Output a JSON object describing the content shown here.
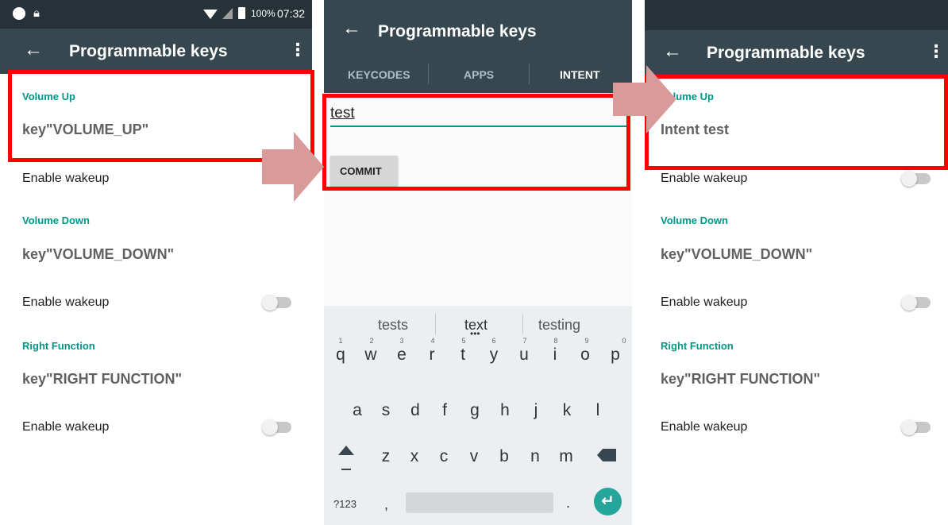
{
  "status_bar": {
    "battery": "100%",
    "time": "07:32"
  },
  "screen1": {
    "title": "Programmable keys",
    "items": [
      {
        "category": "Volume Up",
        "value": "key\"VOLUME_UP\"",
        "wakeup": "Enable wakeup"
      },
      {
        "category": "Volume Down",
        "value": "key\"VOLUME_DOWN\"",
        "wakeup": "Enable wakeup"
      },
      {
        "category": "Right Function",
        "value": "key\"RIGHT FUNCTION\"",
        "wakeup": "Enable wakeup"
      }
    ]
  },
  "screen2": {
    "title": "Programmable keys",
    "tabs": [
      "KEYCODES",
      "APPS",
      "INTENT"
    ],
    "input_value": "test",
    "commit_label": "COMMIT",
    "suggestions": [
      "tests",
      "text",
      "testing"
    ],
    "rows": {
      "row1": [
        "q",
        "w",
        "e",
        "r",
        "t",
        "y",
        "u",
        "i",
        "o",
        "p"
      ],
      "row1_hints": [
        "1",
        "2",
        "3",
        "4",
        "5",
        "6",
        "7",
        "8",
        "9",
        "0"
      ],
      "row2": [
        "a",
        "s",
        "d",
        "f",
        "g",
        "h",
        "j",
        "k",
        "l"
      ],
      "row3": [
        "z",
        "x",
        "c",
        "v",
        "b",
        "n",
        "m"
      ]
    },
    "symbols_key": "?123",
    "comma_key": ",",
    "period_key": "."
  },
  "screen3": {
    "title": "Programmable keys",
    "items": [
      {
        "category": "Volume Up",
        "value": "Intent test",
        "wakeup": "Enable wakeup"
      },
      {
        "category": "Volume Down",
        "value": "key\"VOLUME_DOWN\"",
        "wakeup": "Enable wakeup"
      },
      {
        "category": "Right Function",
        "value": "key\"RIGHT FUNCTION\"",
        "wakeup": "Enable wakeup"
      }
    ]
  },
  "icons": {
    "back": "back-arrow-icon",
    "overflow": "overflow-menu-icon",
    "shift": "shift-icon",
    "backspace": "backspace-icon",
    "enter": "enter-icon"
  },
  "colors": {
    "appbar": "#37474f",
    "status_bar": "#263238",
    "accent": "#009688",
    "highlight": "#ff0000",
    "arrow": "#d99a9a"
  }
}
